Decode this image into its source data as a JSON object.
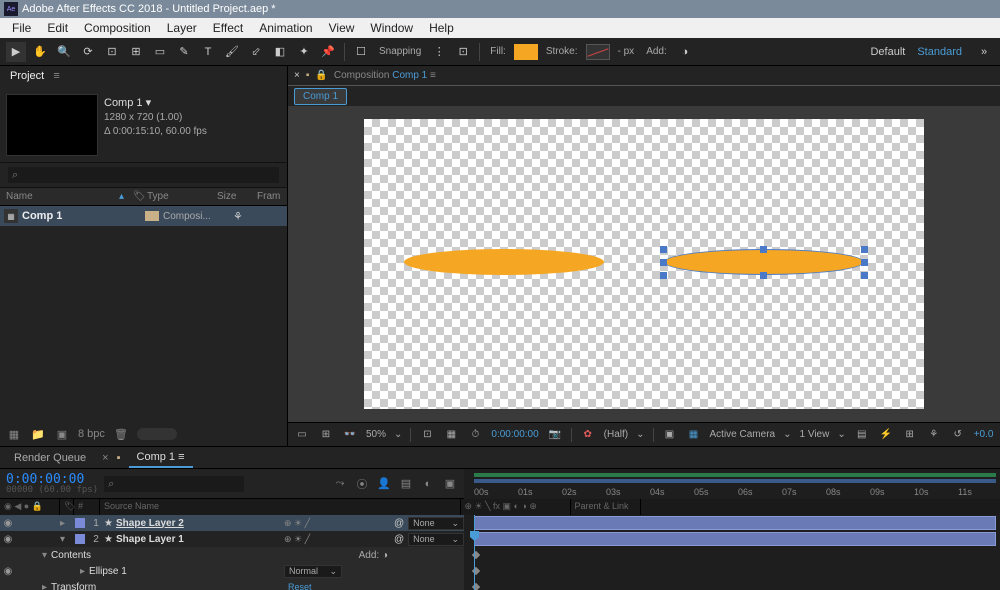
{
  "app": {
    "title": "Adobe After Effects CC 2018 - Untitled Project.aep *",
    "icon_label": "Ae"
  },
  "menu": [
    "File",
    "Edit",
    "Composition",
    "Layer",
    "Effect",
    "Animation",
    "View",
    "Window",
    "Help"
  ],
  "toolbar": {
    "snapping": "Snapping",
    "fill": "Fill:",
    "stroke": "Stroke:",
    "stroke_px": "- px",
    "add": "Add:",
    "default": "Default",
    "workspace": "Standard"
  },
  "project": {
    "tab": "Project",
    "comp_name": "Comp 1",
    "dims": "1280 x 720 (1.00)",
    "dur": "Δ 0:00:15:10, 60.00 fps",
    "search_placeholder": "⌕",
    "cols": {
      "name": "Name",
      "type": "Type",
      "size": "Size",
      "fr": "Fram"
    },
    "item": {
      "name": "Comp 1",
      "type": "Composi..."
    },
    "bpc": "8 bpc"
  },
  "comp_panel": {
    "close": "×",
    "lock": "🔒",
    "crumb_label": "Composition",
    "crumb_link": "Comp 1",
    "tab": "Comp 1"
  },
  "viewer_footer": {
    "zoom": "50%",
    "time": "0:00:00:00",
    "res": "(Half)",
    "camera": "Active Camera",
    "view": "1 View",
    "exposure": "+0.0"
  },
  "timeline": {
    "tabs": {
      "render": "Render Queue",
      "comp": "Comp 1"
    },
    "timecode": "0:00:00:00",
    "timecode_sub": "00000 (60.00 fps)",
    "search_placeholder": "⌕",
    "cols": {
      "idx": "#",
      "source": "Source Name",
      "parent": "Parent & Link"
    },
    "switches_hdr": "⊕ ☀ ╲ fx ▣ ◐ ◑ ⊕",
    "ticks": [
      "00s",
      "01s",
      "02s",
      "03s",
      "04s",
      "05s",
      "06s",
      "07s",
      "08s",
      "09s",
      "10s",
      "11s"
    ],
    "layers": [
      {
        "idx": "1",
        "name": "Shape Layer 2",
        "mode": "None",
        "selected": true
      },
      {
        "idx": "2",
        "name": "Shape Layer 1",
        "mode": "None",
        "selected": false
      }
    ],
    "sub": {
      "contents": "Contents",
      "add": "Add:",
      "ellipse": "Ellipse 1",
      "ellipse_mode": "Normal",
      "transform": "Transform",
      "reset": "Reset"
    }
  }
}
